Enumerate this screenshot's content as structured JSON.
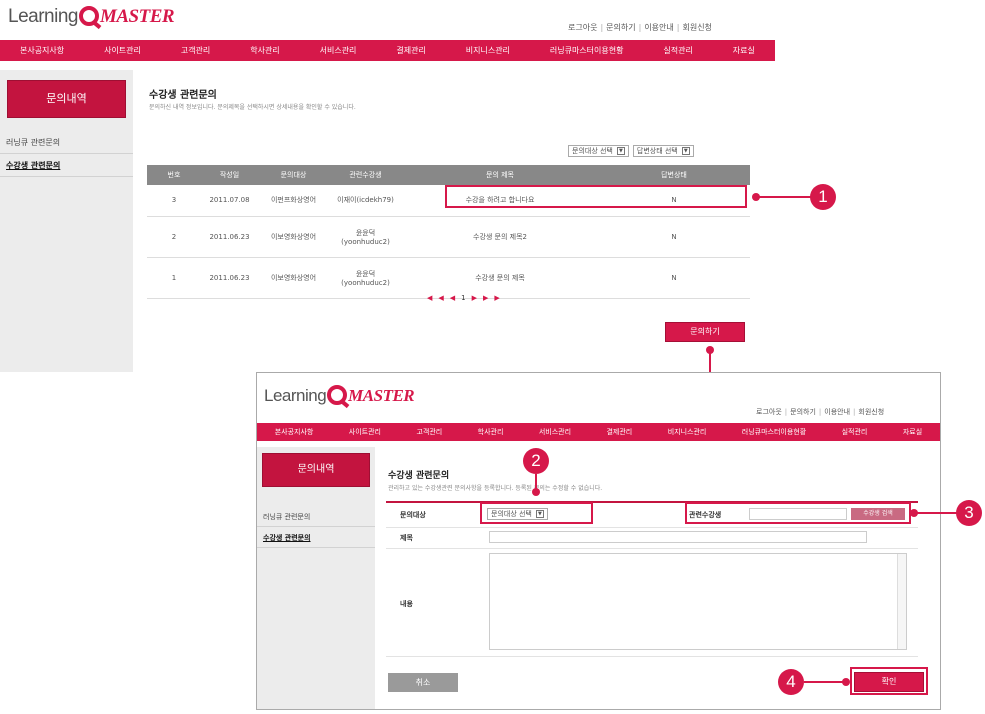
{
  "logo": {
    "prefix": "Learning",
    "q": "Q",
    "suffix": "MASTER"
  },
  "toplinks": [
    "로그아웃",
    "문의하기",
    "이용안내",
    "회원신청"
  ],
  "nav": [
    "본사공지사항",
    "사이트관리",
    "고객관리",
    "학사관리",
    "서비스관리",
    "결제관리",
    "비지니스관리",
    "러닝큐마스터이용현황",
    "실적관리",
    "자료실"
  ],
  "sidebar": {
    "title": "문의내역",
    "items": [
      "러닝큐 관련문의",
      "수강생 관련문의"
    ]
  },
  "list_page": {
    "title": "수강생 관련문의",
    "desc": "문의하신 내역 정보입니다. 문의제목을 선택하시면 상세내용을 확인할 수 있습니다.",
    "filter_target": "문의대상 선택",
    "filter_status": "답변상태 선택",
    "columns": [
      "번호",
      "작성일",
      "문의대상",
      "관련수강생",
      "문의 제목",
      "답변상태"
    ],
    "rows": [
      {
        "no": "3",
        "date": "2011.07.08",
        "target": "이펀프화상영어",
        "student": "이재이(icdekh79)",
        "student_sub": "",
        "subject": "수강을 하려고 합니다요",
        "status": "N"
      },
      {
        "no": "2",
        "date": "2011.06.23",
        "target": "이보영화상영어",
        "student": "윤윤덕",
        "student_sub": "(yoonhuduc2)",
        "subject": "수강생 문의 제목2",
        "status": "N"
      },
      {
        "no": "1",
        "date": "2011.06.23",
        "target": "이보영화상영어",
        "student": "윤윤덕",
        "student_sub": "(yoonhuduc2)",
        "subject": "수강생 문의 제목",
        "status": "N"
      }
    ],
    "pager": [
      "◀◀",
      "◀",
      "1",
      "▶",
      "▶▶"
    ],
    "inquire_button": "문의하기"
  },
  "form_page": {
    "title": "수강생 관련문의",
    "desc": "관리하고 있는 수강생관련 문의사항을 등록합니다. 등록된 문의는 수정할 수 없습니다.",
    "target_label": "문의대상",
    "target_select": "문의대상 선택",
    "student_label": "관련수강생",
    "student_search_button": "수강생 검색",
    "subject_label": "제목",
    "content_label": "내용",
    "cancel_button": "취소",
    "confirm_button": "확인"
  },
  "callouts": [
    "1",
    "2",
    "3",
    "4"
  ],
  "colors": {
    "brand": "#d6184a",
    "sidebar_bg": "#ececec",
    "table_header": "#888888"
  }
}
